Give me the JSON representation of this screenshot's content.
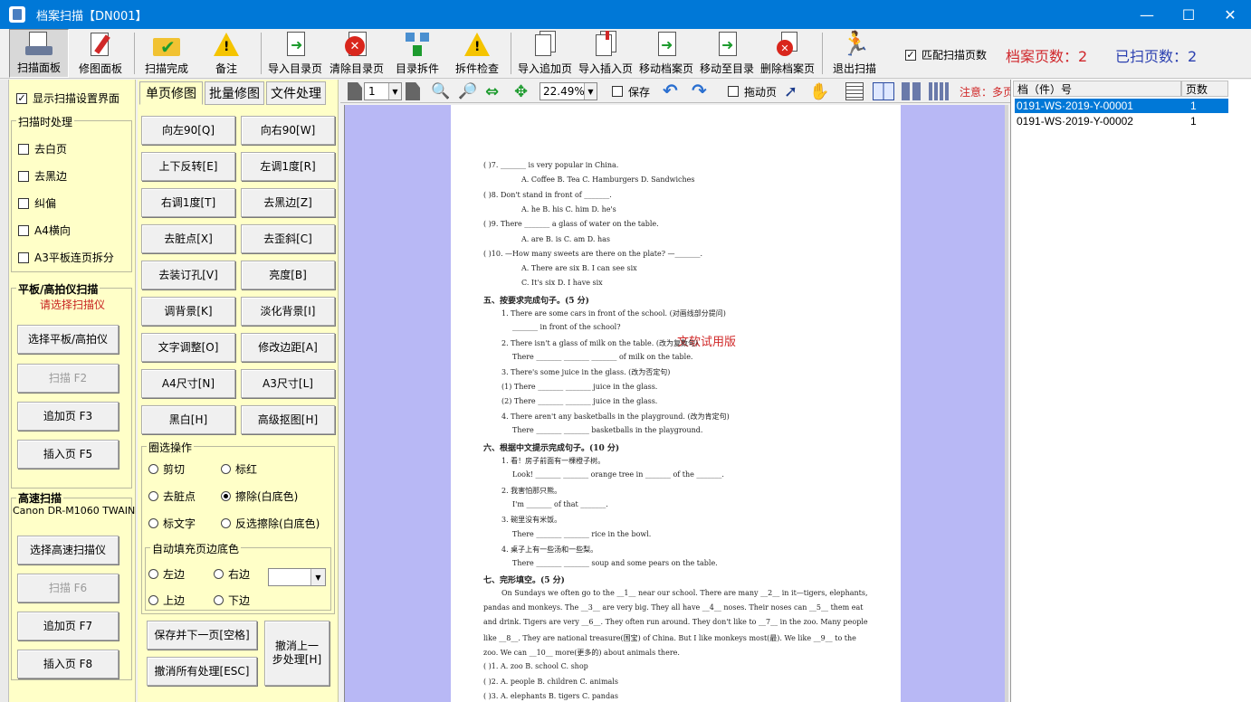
{
  "window": {
    "title": "档案扫描【DN001】",
    "minimize": "—",
    "maximize": "☐",
    "close": "✕"
  },
  "toolbar": {
    "scan_panel": "扫描面板",
    "edit_panel": "修图面板",
    "scan_done": "扫描完成",
    "note": "备注",
    "import_catalog": "导入目录页",
    "clear_catalog": "清除目录页",
    "catalog_split": "目录拆件",
    "split_check": "拆件检查",
    "import_append": "导入追加页",
    "import_insert": "导入插入页",
    "move_archive_page": "移动档案页",
    "move_to_catalog": "移动至目录",
    "delete_archive_page": "删除档案页",
    "exit_scan": "退出扫描",
    "match_pages_label": "匹配扫描页数",
    "match_pages_checked": true,
    "archive_pages": "档案页数：2",
    "scanned_pages": "已扫页数：2"
  },
  "left_panel": {
    "show_settings": "显示扫描设置界面",
    "post_process_title": "扫描时处理",
    "options": [
      "去白页",
      "去黑边",
      "纠偏",
      "A4横向",
      "A3平板连页拆分"
    ],
    "flatbed_title": "平板/高拍仪扫描",
    "flatbed_hint": "请选择扫描仪",
    "select_flatbed": "选择平板/高拍仪",
    "scan_f2": "扫描 F2",
    "append_f3": "追加页 F3",
    "insert_f5": "插入页 F5",
    "highspeed_title": "高速扫描",
    "device_name": "Canon DR-M1060 TWAIN",
    "select_highspeed": "选择高速扫描仪",
    "scan_f6": "扫描 F6",
    "append_f7": "追加页 F7",
    "insert_f8": "插入页 F8"
  },
  "mid_panel": {
    "tabs": [
      "单页修图",
      "批量修图",
      "文件处理"
    ],
    "buttons": [
      "向左90[Q]",
      "向右90[W]",
      "上下反转[E]",
      "左调1度[R]",
      "右调1度[T]",
      "去黑边[Z]",
      "去脏点[X]",
      "去歪斜[C]",
      "去装订孔[V]",
      "亮度[B]",
      "调背景[K]",
      "淡化背景[I]",
      "文字调整[O]",
      "修改边距[A]",
      "A4尺寸[N]",
      "A3尺寸[L]",
      "黑白[H]",
      "高级抠图[H]"
    ],
    "circle_title": "圈选操作",
    "circle_ops": [
      "剪切",
      "标红",
      "去脏点",
      "擦除(白底色)",
      "标文字",
      "反选擦除(白底色)"
    ],
    "circle_selected": "擦除(白底色)",
    "autofill_title": "自动填充页边底色",
    "autofill_ops": [
      "左边",
      "右边",
      "上边",
      "下边"
    ],
    "save_next": "保存并下一页[空格]",
    "undo_all": "撤消所有处理[ESC]",
    "undo_last": "撤消上一步处理[H]"
  },
  "viewer_toolbar": {
    "page_value": "1",
    "zoom_value": "22.49%",
    "save_label": "保存",
    "drag_label": "拖动页",
    "note_label": "注意：多页"
  },
  "document": {
    "watermark": "文软试用版",
    "lines": [
      "(      )7. _______ is very popular in China.",
      "A. Coffee                    B. Tea                    C. Hamburgers                    D. Sandwiches",
      "(      )8. Don't stand in front of _______.",
      "A. he                        B. his                    C. him                           D. he's",
      "(      )9. There _______ a glass of water on the table.",
      "A. are                       B. is                     C. am                            D. has",
      "(      )10. —How many sweets are there on the plate?    —_______.",
      "A. There are six                                  B. I can see six",
      "C. It's six                                       D. I have six",
      "五、按要求完成句子。(5 分)",
      "1. There are some cars in front of the school. (对画线部分提问)",
      "_______ in front of the school?",
      "2. There isn't a glass of milk on the table. (改为复数句)",
      "There _______ _______ _______ of milk on the table.",
      "3. There's some juice in the glass. (改为否定句)",
      "(1) There _______ _______ juice in the glass.",
      "(2) There _______ _______ juice in the glass.",
      "4. There aren't any basketballs in the playground. (改为肯定句)",
      "There _______ _______ basketballs in the playground.",
      "六、根据中文提示完成句子。(10 分)",
      "1. 看！房子前面有一棵橙子树。",
      "Look! _______ _______ orange tree in _______ of the _______.",
      "2. 我害怕那只熊。",
      "I'm _______ of that _______.",
      "3. 碗里没有米饭。",
      "There _______ _______ rice in the bowl.",
      "4. 桌子上有一些汤和一些梨。",
      "There _______ _______ soup and some pears on the table.",
      "七、完形填空。(5 分)",
      "On Sundays we often go to the __1__ near our school. There are many __2__ in it—tigers, elephants,",
      "pandas and monkeys. The __3__ are very big. They all have __4__ noses. Their noses can __5__ them eat",
      "and drink. Tigers are very __6__. They often run around. They don't like to __7__ in the zoo. Many people",
      "like __8__. They are national treasure(国宝) of China. But I like monkeys most(最). We like __9__ to the",
      "zoo. We can __10__ more(更多的) about animals there.",
      "(      )1. A. zoo                              B. school                              C. shop",
      "(      )2. A. people                           B. children                            C. animals",
      "(      )3. A. elephants                        B. tigers                              C. pandas"
    ]
  },
  "right_panel": {
    "col_id": "档（件）号",
    "col_pages": "页数",
    "rows": [
      {
        "id": "0191-WS·2019-Y-00001",
        "pages": "1"
      },
      {
        "id": "0191-WS·2019-Y-00002",
        "pages": "1"
      }
    ]
  }
}
